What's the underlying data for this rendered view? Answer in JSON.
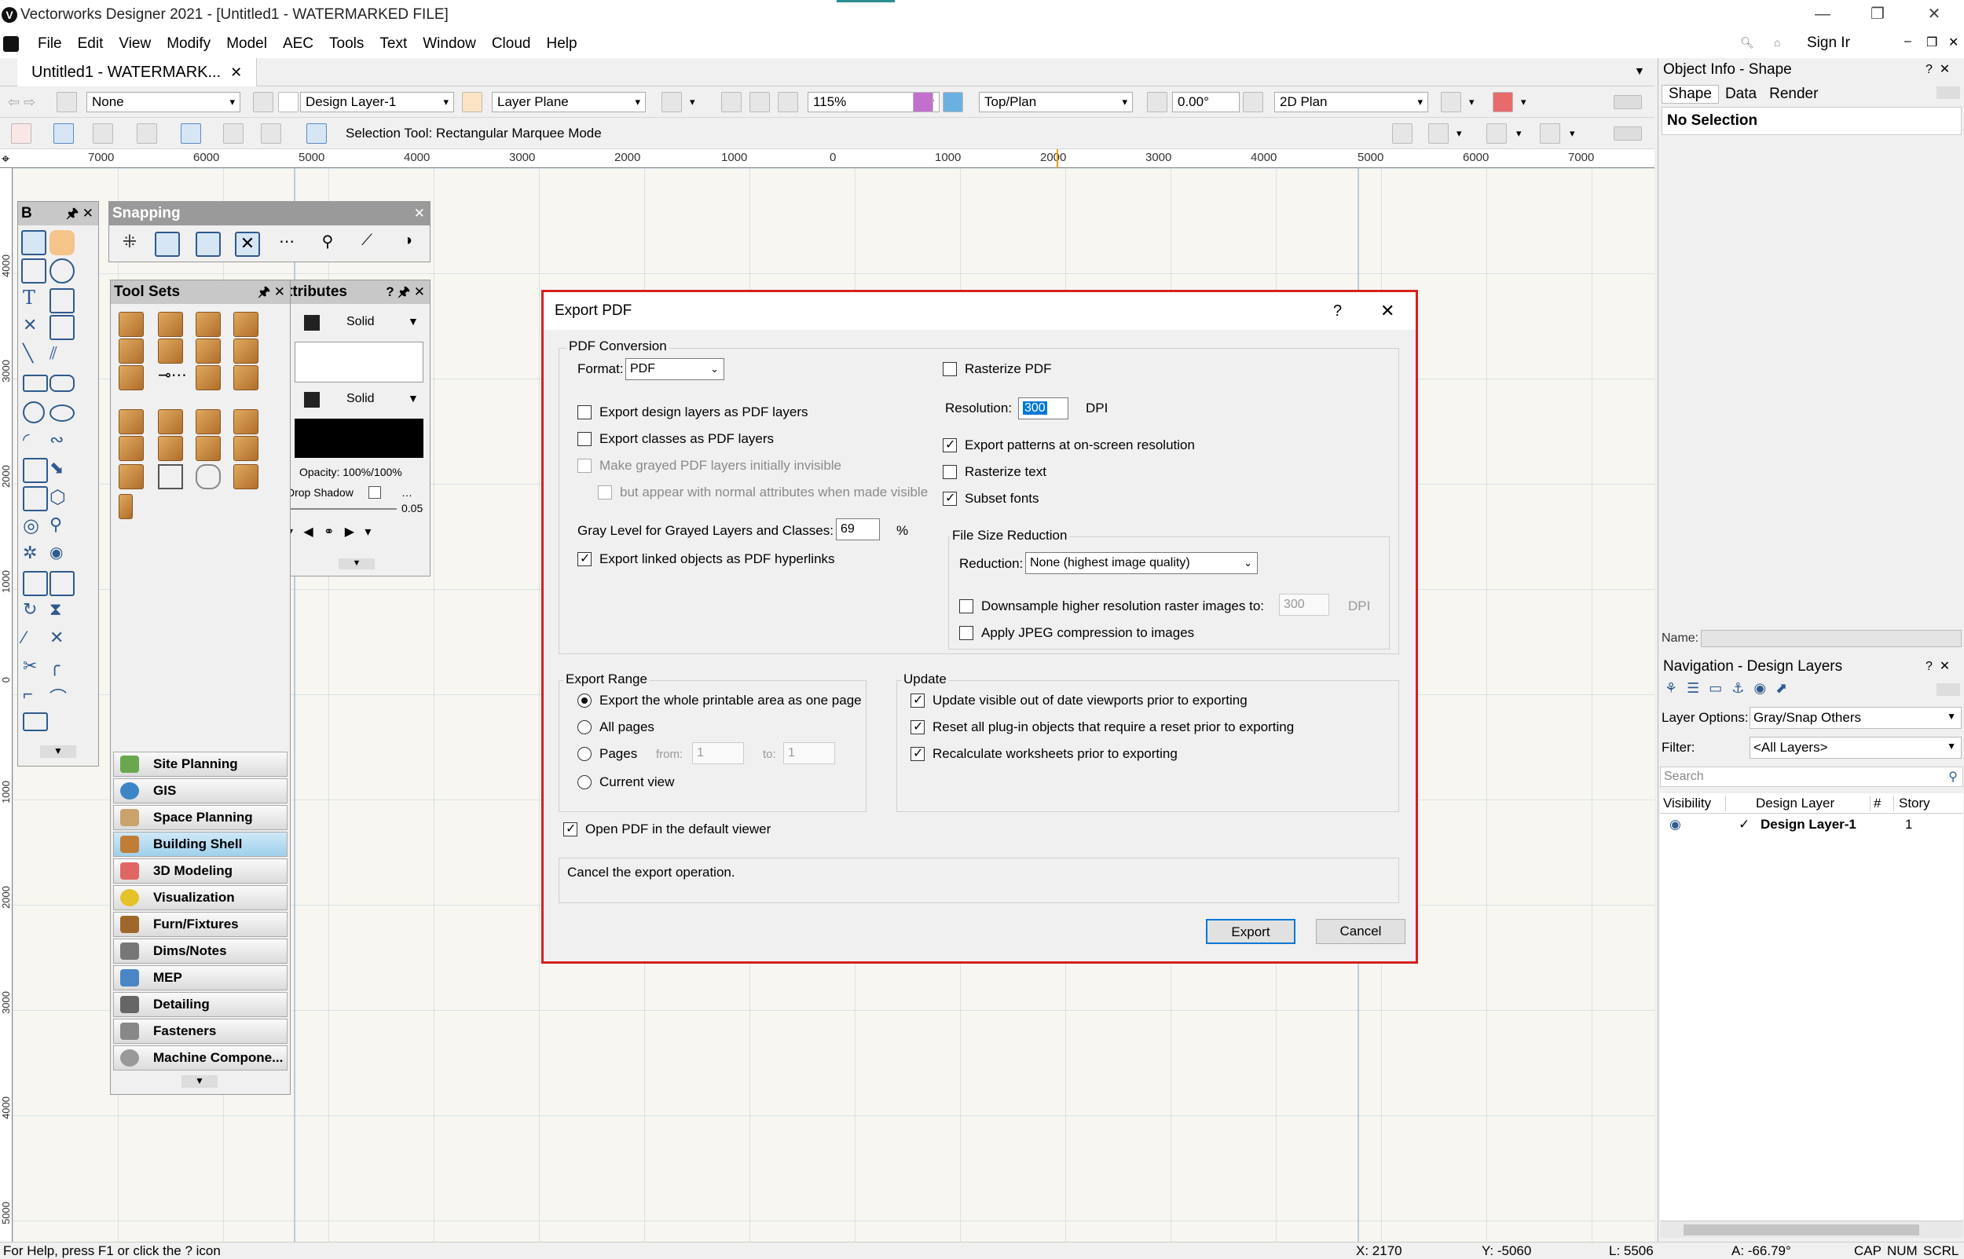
{
  "window": {
    "title": "Vectorworks Designer 2021 - [Untitled1 - WATERMARKED FILE]",
    "app_letter": "V"
  },
  "menu": [
    "File",
    "Edit",
    "View",
    "Modify",
    "Model",
    "AEC",
    "Tools",
    "Text",
    "Window",
    "Cloud",
    "Help"
  ],
  "menu_right": {
    "sign_in": "Sign Ir"
  },
  "doc_tab": {
    "label": "Untitled1 - WATERMARK...",
    "close": "✕"
  },
  "viewbar": {
    "class": "None",
    "layer": "Design Layer-1",
    "plane": "Layer Plane",
    "zoom": "115%",
    "view": "Top/Plan",
    "rotation": "0.00°",
    "render": "2D Plan"
  },
  "toolbar": {
    "mode_text": "Selection Tool: Rectangular Marquee Mode"
  },
  "ruler": {
    "h": [
      "7000",
      "6000",
      "5000",
      "4000",
      "3000",
      "2000",
      "1000",
      "0",
      "1000",
      "2000",
      "3000",
      "4000",
      "5000",
      "6000",
      "7000"
    ],
    "v": [
      "4000",
      "3000",
      "2000",
      "1000",
      "0",
      "1000",
      "2000",
      "3000",
      "4000",
      "5000"
    ]
  },
  "palettes": {
    "basic_title": "B",
    "snapping_title": "Snapping",
    "toolsets_title": "Tool Sets",
    "attributes_title": "ttributes",
    "attr": {
      "fill": "Solid",
      "pen": "Solid",
      "opacity": "Opacity: 100%/100%",
      "drop_shadow": "Drop Shadow",
      "line_weight": "0.05"
    },
    "toolsets": [
      {
        "label": "Site Planning",
        "color": "#6aa84f"
      },
      {
        "label": "GIS",
        "color": "#3d85c6"
      },
      {
        "label": "Space Planning",
        "color": "#c9a36b"
      },
      {
        "label": "Building Shell",
        "color": "#c07d38"
      },
      {
        "label": "3D Modeling",
        "color": "#e06666"
      },
      {
        "label": "Visualization",
        "color": "#e6c229"
      },
      {
        "label": "Furn/Fixtures",
        "color": "#a0672c"
      },
      {
        "label": "Dims/Notes",
        "color": "#777777"
      },
      {
        "label": "MEP",
        "color": "#4a86c5"
      },
      {
        "label": "Detailing",
        "color": "#666666"
      },
      {
        "label": "Fasteners",
        "color": "#888888"
      },
      {
        "label": "Machine Compone...",
        "color": "#999999"
      }
    ],
    "selected_toolset": "Building Shell"
  },
  "object_info": {
    "title": "Object Info - Shape",
    "tabs": [
      "Shape",
      "Data",
      "Render"
    ],
    "selection": "No Selection",
    "name_label": "Name:"
  },
  "navigation": {
    "title": "Navigation - Design Layers",
    "layer_options_label": "Layer Options:",
    "layer_options_value": "Gray/Snap Others",
    "filter_label": "Filter:",
    "filter_value": "<All Layers>",
    "search_placeholder": "Search",
    "columns": [
      "Visibility",
      "Design Layer",
      "#",
      "Story"
    ],
    "rows": [
      {
        "check": "✓",
        "name": "Design Layer-1",
        "num": "1"
      }
    ]
  },
  "status": {
    "help": "For Help, press F1 or click the ? icon",
    "x": "X: 2170",
    "y": "Y: -5060",
    "l": "L: 5506",
    "a": "A: -66.79°",
    "caps": "CAP",
    "num": "NUM",
    "scrl": "SCRL"
  },
  "dialog": {
    "title": "Export PDF",
    "pdf_conversion": "PDF Conversion",
    "format_label": "Format:",
    "format_value": "PDF",
    "export_design_layers": "Export design layers as PDF layers",
    "export_classes": "Export classes as PDF layers",
    "make_grayed": "Make grayed PDF layers initially invisible",
    "but_appear": "but appear with normal attributes when made visible",
    "gray_level_label": "Gray Level for Grayed Layers and Classes:",
    "gray_level_value": "69",
    "gray_unit": "%",
    "export_linked": "Export linked objects as PDF hyperlinks",
    "rasterize_pdf": "Rasterize PDF",
    "resolution_label": "Resolution:",
    "resolution_value": "300",
    "dpi": "DPI",
    "export_patterns": "Export patterns at on-screen resolution",
    "rasterize_text": "Rasterize text",
    "subset_fonts": "Subset fonts",
    "file_size_reduction": "File Size Reduction",
    "reduction_label": "Reduction:",
    "reduction_value": "None (highest image quality)",
    "downsample": "Downsample higher resolution raster images to:",
    "downsample_value": "300",
    "downsample_unit": "DPI",
    "apply_jpeg": "Apply JPEG compression to images",
    "export_range": "Export Range",
    "range_whole": "Export the whole printable area as one page",
    "range_all": "All pages",
    "range_pages": "Pages",
    "from_label": "from:",
    "from_value": "1",
    "to_label": "to:",
    "to_value": "1",
    "range_current": "Current view",
    "update": "Update",
    "update_viewports": "Update visible out of date viewports prior to exporting",
    "reset_plugins": "Reset all plug-in objects that require a reset prior to exporting",
    "recalc_worksheets": "Recalculate worksheets prior to exporting",
    "open_pdf": "Open PDF in the default viewer",
    "help_text": "Cancel the export operation.",
    "export_btn": "Export",
    "cancel_btn": "Cancel"
  }
}
